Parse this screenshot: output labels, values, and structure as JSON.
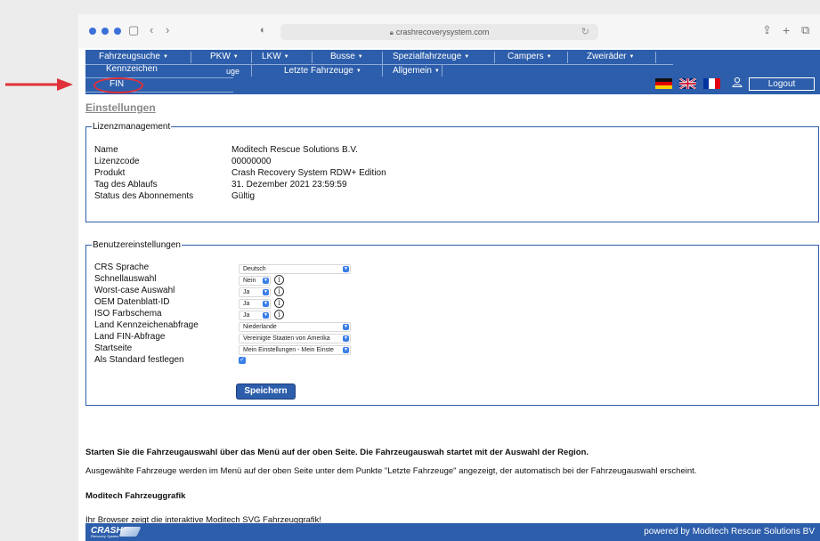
{
  "browser": {
    "url": "crashrecoverysystem.com"
  },
  "nav": {
    "top": [
      {
        "label": "Fahrzeugsuche",
        "caret": "▼"
      },
      {
        "label": "PKW",
        "caret": "▼"
      },
      {
        "label": "LKW",
        "caret": "▼"
      },
      {
        "label": "Busse",
        "caret": "▼"
      },
      {
        "label": "Spezialfahrzeuge",
        "caret": "▼"
      },
      {
        "label": "Campers",
        "caret": "▼"
      },
      {
        "label": "Zweiräder",
        "caret": "▼"
      }
    ],
    "second": [
      {
        "label": "uge"
      },
      {
        "label": "Letzte Fahrzeuge",
        "caret": "▼"
      },
      {
        "label": "Allgemein",
        "caret": "▼"
      }
    ],
    "dropdown": {
      "kennzeichen": "Kennzeichen",
      "fin": "FIN"
    },
    "logout": "Logout",
    "flags": [
      "german-flag-icon",
      "uk-flag-icon",
      "french-flag-icon"
    ],
    "user_icon": "user-icon"
  },
  "page": {
    "title": "Einstellungen"
  },
  "license": {
    "legend": "Lizenzmanagement",
    "rows": [
      {
        "label": "Name",
        "value": "Moditech Rescue Solutions B.V."
      },
      {
        "label": "Lizenzcode",
        "value": "00000000"
      },
      {
        "label": "Produkt",
        "value": "Crash Recovery System RDW+ Edition"
      },
      {
        "label": "Tag des Ablaufs",
        "value": "31. Dezember 2021 23:59:59"
      },
      {
        "label": "Status des Abonnements",
        "value": "Gültig"
      }
    ]
  },
  "user_settings": {
    "legend": "Benutzereinstellungen",
    "rows": [
      {
        "label": "CRS Sprache",
        "value": "Deutsch"
      },
      {
        "label": "Schnellauswahl",
        "value": "Nein"
      },
      {
        "label": "Worst-case Auswahl",
        "value": "Ja"
      },
      {
        "label": "OEM Datenblatt-ID",
        "value": "Ja"
      },
      {
        "label": "ISO Farbschema",
        "value": "Ja"
      },
      {
        "label": "Land Kennzeichenabfrage",
        "value": "Niederlande"
      },
      {
        "label": "Land FIN-Abfrage",
        "value": "Vereinigte Staaten von Amerika"
      },
      {
        "label": "Startseite",
        "value": "Mein Einstellungen - Mein Einste"
      },
      {
        "label": "Als Standard festlegen",
        "value": "✓"
      }
    ],
    "info_glyph": "i",
    "save": "Speichern"
  },
  "text": {
    "intro": "Starten Sie die Fahrzeugauswahl über das Menü auf der oben Seite. Die Fahrzeugauswah startet mit der Auswahl der Region.",
    "selected": "Ausgewählte Fahrzeuge werden im Menü auf der oben Seite unter dem Punkte \"Letzte Fahrzeuge\" angezeigt, der automatisch bei der Fahrzeugauswahl erscheint.",
    "graphic_heading": "Moditech Fahrzeuggrafik",
    "graphic_text": "Ihr Browser zeigt die interaktive Moditech SVG Fahrzeuggrafik!"
  },
  "footer": {
    "brand": "CRASH",
    "brand_sub": "Recovery System",
    "powered": "powered by Moditech Rescue Solutions BV"
  },
  "colors": {
    "nav_blue": "#2d5eab",
    "annotation_red": "#e0303a",
    "checkbox_blue": "#3a7ee8"
  }
}
